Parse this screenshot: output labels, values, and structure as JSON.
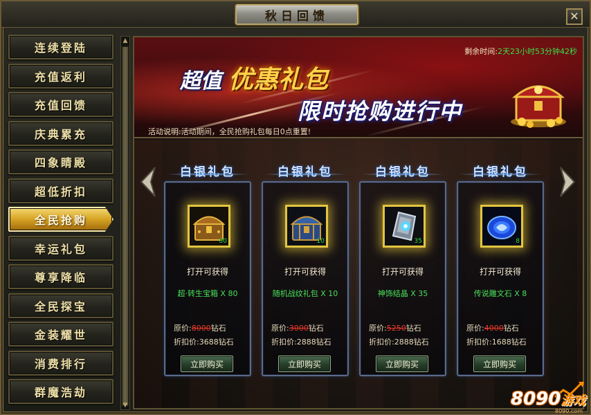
{
  "window": {
    "title": "秋日回馈",
    "close_label": "✕"
  },
  "sidebar": {
    "items": [
      {
        "label": "连续登陆",
        "active": false
      },
      {
        "label": "充值返利",
        "active": false
      },
      {
        "label": "充值回馈",
        "active": false
      },
      {
        "label": "庆典累充",
        "active": false
      },
      {
        "label": "四象睛殿",
        "active": false
      },
      {
        "label": "超低折扣",
        "active": false
      },
      {
        "label": "全民抢购",
        "active": true
      },
      {
        "label": "幸运礼包",
        "active": false
      },
      {
        "label": "尊享降临",
        "active": false
      },
      {
        "label": "全民探宝",
        "active": false
      },
      {
        "label": "金装耀世",
        "active": false
      },
      {
        "label": "消费排行",
        "active": false
      },
      {
        "label": "群魔浩劫",
        "active": false
      }
    ]
  },
  "banner": {
    "headline_white": "超值",
    "headline_gold": "优惠礼包",
    "headline_2": "限时抢购进行中",
    "remaining_label": "剩余时间:",
    "remaining_value": "2天23小时53分钟42秒",
    "desc_label": "活动说明:",
    "desc_value": "活动期间，全民抢购礼包每日0点重置!"
  },
  "cards": [
    {
      "title": "白银礼包",
      "icon": "treasure-chest-gold",
      "count": "80",
      "open_label": "打开可获得",
      "item_name": "超·转生宝箱 X 80",
      "orig_label": "原价:",
      "orig_price": "8000",
      "orig_unit": "钻石",
      "disc_label": "折扣价:",
      "disc_price": "3688钻石",
      "buy_label": "立即购买"
    },
    {
      "title": "白银礼包",
      "icon": "treasure-chest-blue",
      "count": "10",
      "open_label": "打开可获得",
      "item_name": "随机战纹礼包 X 10",
      "orig_label": "原价:",
      "orig_price": "3000",
      "orig_unit": "钻石",
      "disc_label": "折扣价:",
      "disc_price": "2888钻石",
      "buy_label": "立即购买"
    },
    {
      "title": "白银礼包",
      "icon": "crystal-shard",
      "count": "35",
      "open_label": "打开可获得",
      "item_name": "神饰结晶 X 35",
      "orig_label": "原价:",
      "orig_price": "5250",
      "orig_unit": "钻石",
      "disc_label": "折扣价:",
      "disc_price": "2888钻石",
      "buy_label": "立即购买"
    },
    {
      "title": "白银礼包",
      "icon": "rune-stone-blue",
      "count": "8",
      "open_label": "打开可获得",
      "item_name": "传说雕文石 X 8",
      "orig_label": "原价:",
      "orig_price": "4000",
      "orig_unit": "钻石",
      "disc_label": "折扣价:",
      "disc_price": "1688钻石",
      "buy_label": "立即购买"
    }
  ],
  "watermark": {
    "brand": "8090",
    "brand_cn": "游戏",
    "site": "8090.com"
  },
  "colors": {
    "accent_gold": "#ffd24a",
    "timer_green": "#38e046",
    "price_red": "#e83a2a"
  }
}
